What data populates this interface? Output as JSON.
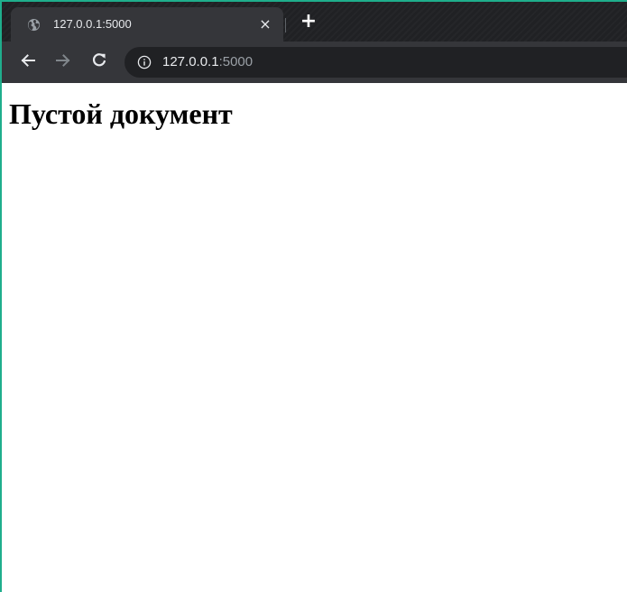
{
  "tab": {
    "title": "127.0.0.1:5000",
    "favicon": "globe-icon",
    "close_label": "×"
  },
  "new_tab": {
    "label": "+"
  },
  "toolbar": {
    "back_icon": "arrow-left-icon",
    "forward_icon": "arrow-right-icon",
    "reload_icon": "reload-icon"
  },
  "address_bar": {
    "info_icon": "info-icon",
    "host": "127.0.0.1",
    "port": ":5000"
  },
  "page": {
    "heading": "Пустой документ"
  },
  "colors": {
    "tabstrip": "#202124",
    "toolbar": "#35363a",
    "omnibox": "#202124",
    "accent_border": "#1fae8c"
  }
}
